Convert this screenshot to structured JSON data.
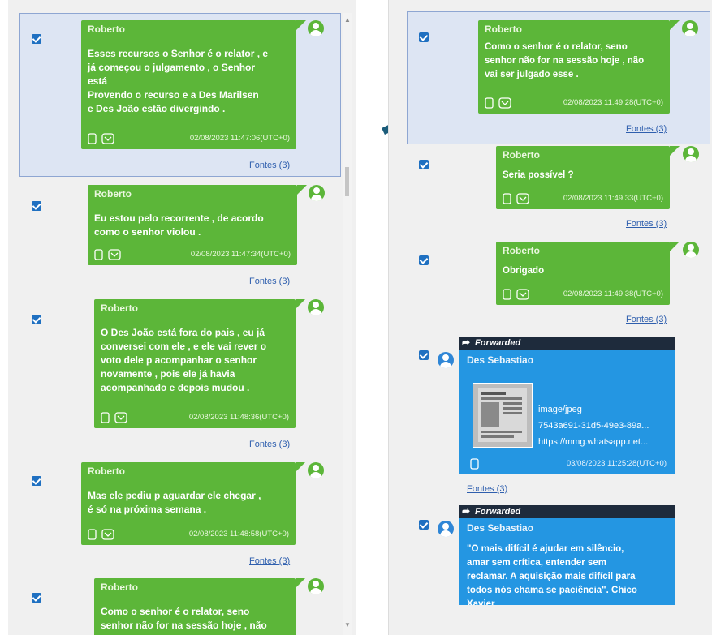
{
  "left_pane": {
    "messages": [
      {
        "sender": "Roberto",
        "lines": [
          "Esses recursos o Senhor é o relator , e",
          "já começou o julgamento , o Senhor",
          "está",
          "Provendo o recurso e a Des Marilsen",
          "e Des João estão divergindo ."
        ],
        "timestamp": "02/08/2023 11:47:06(UTC+0)",
        "sources": "Fontes (3)"
      },
      {
        "sender": "Roberto",
        "lines": [
          "Eu estou pelo recorrente , de acordo",
          "como o senhor violou ."
        ],
        "timestamp": "02/08/2023 11:47:34(UTC+0)",
        "sources": "Fontes (3)"
      },
      {
        "sender": "Roberto",
        "lines": [
          "O Des João está fora do pais , eu já",
          "conversei com ele , e ele vai rever o",
          "voto dele p acompanhar o senhor",
          "novamente , pois ele já havia",
          "acompanhado e depois mudou ."
        ],
        "timestamp": "02/08/2023 11:48:36(UTC+0)",
        "sources": "Fontes (3)"
      },
      {
        "sender": "Roberto",
        "lines": [
          "Mas ele pediu p aguardar ele chegar ,",
          "é só na próxima semana ."
        ],
        "timestamp": "02/08/2023 11:48:58(UTC+0)",
        "sources": "Fontes (3)"
      },
      {
        "sender": "Roberto",
        "lines": [
          "Como o senhor é o relator, seno",
          "senhor não for na sessão hoje , não"
        ]
      }
    ]
  },
  "right_pane": {
    "messages": [
      {
        "sender": "Roberto",
        "lines": [
          "Como o senhor é o relator, seno",
          "senhor não for na sessão hoje , não",
          "vai ser julgado esse ."
        ],
        "timestamp": "02/08/2023 11:49:28(UTC+0)",
        "sources": "Fontes (3)"
      },
      {
        "sender": "Roberto",
        "lines": [
          "Seria possível ?"
        ],
        "timestamp": "02/08/2023 11:49:33(UTC+0)",
        "sources": "Fontes (3)"
      },
      {
        "sender": "Roberto",
        "lines": [
          "Obrigado"
        ],
        "timestamp": "02/08/2023 11:49:38(UTC+0)",
        "sources": "Fontes (3)"
      }
    ],
    "forwarded": [
      {
        "label": "Forwarded",
        "sender": "Des Sebastiao",
        "attachment": {
          "type": "image/jpeg",
          "id": "7543a691-31d5-49e3-89a...",
          "url": "https://mmg.whatsapp.net..."
        },
        "timestamp": "03/08/2023 11:25:28(UTC+0)",
        "sources": "Fontes (3)"
      },
      {
        "label": "Forwarded",
        "sender": "Des Sebastiao",
        "lines": [
          "\"O mais difícil é ajudar em silêncio,",
          "amar sem crítica, entender sem",
          "reclamar. A aquisição mais difícil para",
          "todos nós chama se paciência\". Chico",
          "Xavier"
        ]
      }
    ]
  },
  "colors": {
    "bubble_green": "#5cb639",
    "forwarded_blue": "#2496e2",
    "forwarded_header": "#1e2b3c",
    "checkbox_blue": "#1f70c1",
    "selection_bg": "#dde5f3",
    "pointer_arrow": "#1b5c7a"
  }
}
